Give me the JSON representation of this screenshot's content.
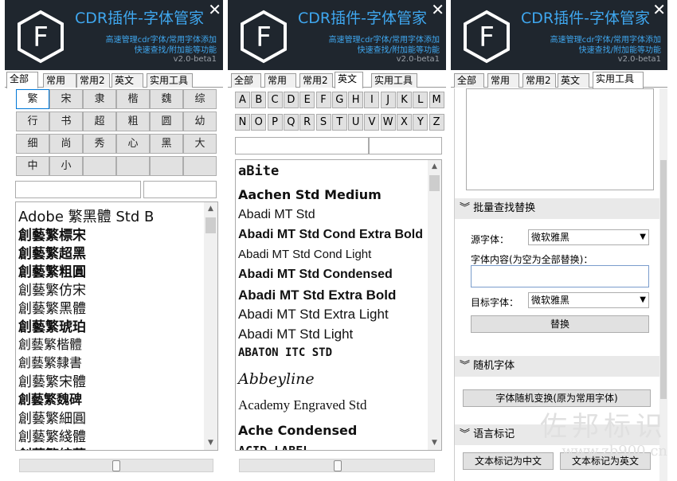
{
  "app": {
    "title": "CDR插件-字体管家",
    "subtitle_line1": "高速管理cdr字体/常用字体添加",
    "subtitle_line2": "快速查找/附加能等功能",
    "version": "v2.0-beta1",
    "logo_letter": "F",
    "close_glyph": "✕"
  },
  "tabs": [
    "全部",
    "常用",
    "常用2",
    "英文",
    "实用工具"
  ],
  "panel1": {
    "char_buttons": [
      "繁",
      "宋",
      "隶",
      "楷",
      "魏",
      "综",
      "行",
      "书",
      "超",
      "粗",
      "圆",
      "幼",
      "细",
      "尚",
      "秀",
      "心",
      "黑",
      "大",
      "中",
      "小",
      "",
      "",
      "",
      ""
    ],
    "fonts": [
      "Adobe 繁黑體 Std B",
      "創藝繁標宋",
      "創藝繁超黑",
      "創藝繁粗圓",
      "創藝繁仿宋",
      "創藝繁黑體",
      "創藝繁琥珀",
      "創藝繁楷體",
      "創藝繁隸書",
      "創藝繁宋體",
      "創藝繁魏碑",
      "創藝繁細圓",
      "創藝繁綫體",
      "創藝繁綜藝"
    ]
  },
  "panel2": {
    "letters_row1": [
      "A",
      "B",
      "C",
      "D",
      "E",
      "F",
      "G",
      "H",
      "I",
      "J",
      "K",
      "L",
      "M"
    ],
    "letters_row2": [
      "N",
      "O",
      "P",
      "Q",
      "R",
      "S",
      "T",
      "U",
      "V",
      "W",
      "X",
      "Y",
      "Z"
    ],
    "fonts": [
      "aBite",
      "Aachen Std Medium",
      "Abadi MT Std",
      "Abadi MT Std Cond Extra Bold",
      "Abadi MT Std Cond Light",
      "Abadi MT Std Condensed",
      "Abadi MT Std Extra Bold",
      "Abadi MT Std Extra Light",
      "Abadi MT Std Light",
      "ABATON ITC STD",
      "Abbeyline",
      "Academy Engraved Std",
      "Ache Condensed",
      "ACID LABEL"
    ]
  },
  "panel3": {
    "section_batch": "批量查找替换",
    "source_font_label": "源字体：",
    "source_font_value": "微软雅黑",
    "content_label": "字体内容(为空为全部替换)：",
    "content_value": "",
    "target_font_label": "目标字体：",
    "target_font_value": "微软雅黑",
    "replace_button": "替换",
    "section_random": "随机字体",
    "random_button": "字体随机变换(原为常用字体)",
    "section_lang": "语言标记",
    "mark_cn_button": "文本标记为中文",
    "mark_en_button": "文本标记为英文"
  },
  "watermark": {
    "line1": "佐邦标识",
    "line2": "www.zb900.cn"
  },
  "colors": {
    "header_bg": "#1f262e",
    "accent": "#3fa7ef"
  }
}
